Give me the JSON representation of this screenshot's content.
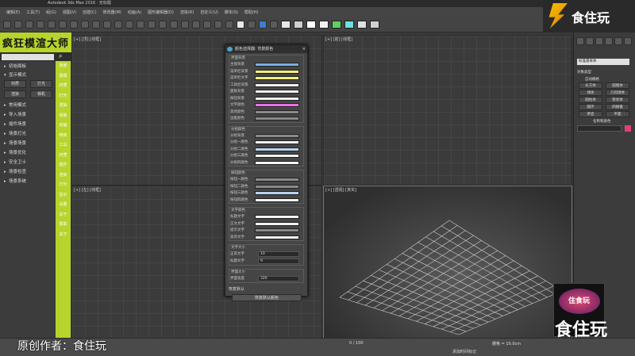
{
  "titlebar": {
    "title": "Autodesk 3ds Max 2016 · 无标题"
  },
  "menubar": {
    "items": [
      "编辑(E)",
      "工具(T)",
      "组(G)",
      "视图(V)",
      "创建(C)",
      "修改器(M)",
      "动画(A)",
      "图形编辑器(D)",
      "渲染(R)",
      "自定义(U)",
      "脚本(S)",
      "帮助(H)"
    ]
  },
  "left_panel": {
    "brand": "疯狂模渲大师",
    "search_icon": "search-icon",
    "rows": [
      "初始面板",
      "显示模式"
    ],
    "buttons": [
      [
        "材质",
        "灯光"
      ],
      [
        "渲染",
        "相机"
      ]
    ],
    "list": [
      "常用模式",
      "导入场景",
      "插件场景",
      "场景灯光",
      "场景场景",
      "场景优化",
      "安全卫士",
      "场景检查",
      "场景系统"
    ]
  },
  "side_column": [
    "场景",
    "建模",
    "材质",
    "灯光",
    "渲染",
    "场景",
    "动画",
    "特效",
    "工具",
    "材质",
    "插件",
    "渲染",
    "灯光",
    "显示",
    "设置",
    "关于",
    "帮助",
    "关于"
  ],
  "viewports": {
    "top": "[+] [顶] [线框]",
    "front": "[+] [前] [线框]",
    "left": "[+] [左] [线框]",
    "persp": "[+] [透视] [真实]"
  },
  "dialog": {
    "title": "颜色选择器: 背景颜色",
    "group1": {
      "label": "界面背景",
      "rows": [
        "主窗背景",
        "菜单栏背景",
        "菜单栏文字",
        "工具栏背景",
        "面板背景",
        "按钮背景",
        "文字颜色",
        "高亮颜色",
        "边框颜色"
      ]
    },
    "group2": {
      "label": "分组颜色",
      "rows": [
        "分组背景",
        "分组一颜色",
        "分组二颜色",
        "分组三颜色",
        "分组四颜色"
      ]
    },
    "group3": {
      "label": "按钮颜色",
      "rows": [
        "按钮一颜色",
        "按钮二颜色",
        "按钮三颜色",
        "按钮四颜色"
      ]
    },
    "group4": {
      "label": "文字颜色",
      "rows": [
        "标题文字",
        "正文文字",
        "提示文字",
        "高亮文字"
      ]
    },
    "group5": {
      "label": "文字大小",
      "spinners": [
        {
          "label": "正常文字",
          "value": "10"
        },
        {
          "label": "标题文字",
          "value": "9"
        }
      ]
    },
    "group6": {
      "label": "界面大小",
      "spinners": [
        {
          "label": "界面宽度",
          "value": "320"
        }
      ]
    },
    "reset_label": "恢复默认",
    "apply_label": "恢复默认颜色"
  },
  "right_panel": {
    "dropdown": "标准基本体",
    "rollout": "对象类型",
    "autogrid": "自动栅格",
    "grid_buttons": [
      "长方体",
      "圆锥体",
      "球体",
      "几何球体",
      "圆柱体",
      "管状体",
      "圆环",
      "四棱锥",
      "茶壶",
      "平面"
    ],
    "name_rollout": "名称和颜色"
  },
  "statusbar": {
    "credit": "原创作者：食住玩",
    "frame": "0 / 100",
    "grid": "栅格 = 10.0cm",
    "time": "添加时间标记"
  },
  "watermark": {
    "top_right": "食住玩",
    "bottom_right": "食住玩",
    "stamp_text": "住食玩"
  },
  "colors": {
    "accent": "#b6d42c",
    "dialog_blue": "#7ab0e0",
    "dialog_yellow": "#f2ef7a",
    "dialog_magenta": "#e870e8",
    "dialog_white": "#f2f2f2",
    "dialog_gray": "#8a8a8a"
  }
}
